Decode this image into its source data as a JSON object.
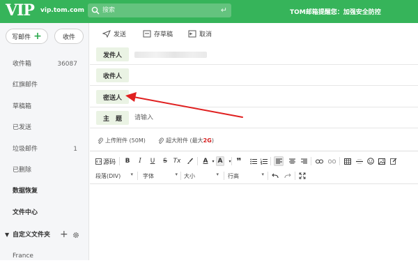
{
  "header": {
    "logo": "VIP",
    "domain": "vip.tom.com",
    "search_placeholder": "搜索",
    "notice": "TOM邮箱提醒您：加强安全防控"
  },
  "sidebar": {
    "compose_label": "写邮件",
    "receive_label": "收件",
    "folders": [
      {
        "label": "收件箱",
        "count": "36087"
      },
      {
        "label": "红旗邮件",
        "count": ""
      },
      {
        "label": "草稿箱",
        "count": ""
      },
      {
        "label": "已发送",
        "count": ""
      },
      {
        "label": "垃圾邮件",
        "count": "1"
      },
      {
        "label": "已删除",
        "count": ""
      },
      {
        "label": "数据恢复",
        "count": ""
      },
      {
        "label": "文件中心",
        "count": ""
      }
    ],
    "custom_folders_label": "自定义文件夹",
    "custom_folder_items": [
      "France"
    ]
  },
  "toolbar": {
    "send": "发送",
    "save_draft": "存草稿",
    "cancel": "取消"
  },
  "compose": {
    "from_label": "发件人",
    "to_label": "收件人",
    "bcc_label": "密送人",
    "subject_label": "主　题",
    "subject_placeholder": "请输入"
  },
  "attachments": {
    "upload": "上传附件 (50M)",
    "large_prefix": "超大附件 (最大 ",
    "large_size": "2G",
    "large_suffix": ")"
  },
  "editor": {
    "source": "源码",
    "bold": "B",
    "italic": "I",
    "underline": "U",
    "strike": "S",
    "clear_format": "Tx",
    "font_color": "A",
    "bg_color": "A",
    "quote": "❞",
    "paragraph_select": "段落(DIV)",
    "font_select": "字体",
    "size_select": "大小",
    "line_height_select": "行高"
  },
  "colors": {
    "header_green": "#36b45a",
    "label_green_bg": "#eaf3e4",
    "annotation_red": "#e02020"
  }
}
